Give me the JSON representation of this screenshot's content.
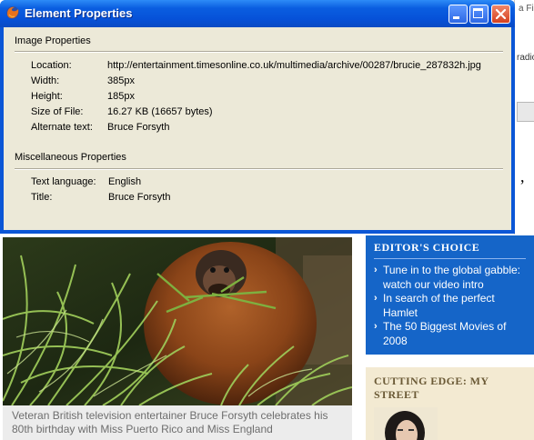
{
  "background_page": {
    "right_snippet_top": "a Fi",
    "right_snippet_radio": "radio",
    "right_snippet_comma": ",",
    "caption": "Veteran British television entertainer Bruce Forsyth celebrates his 80th birthday with Miss Puerto Rico and Miss England",
    "editors_choice": {
      "title": "EDITOR'S CHOICE",
      "items": [
        "Tune in to the global gabble: watch our video intro",
        "In search of the perfect Hamlet",
        "The 50 Biggest Movies of 2008"
      ]
    },
    "cutting_edge": {
      "title": "CUTTING EDGE: MY STREET"
    }
  },
  "dialog": {
    "title": "Element Properties",
    "image_section": {
      "heading": "Image Properties",
      "rows": [
        {
          "label": "Location:",
          "value": "http://entertainment.timesonline.co.uk/multimedia/archive/00287/brucie_287832h.jpg"
        },
        {
          "label": "Width:",
          "value": "385px"
        },
        {
          "label": "Height:",
          "value": "185px"
        },
        {
          "label": "Size of File:",
          "value": "16.27 KB (16657 bytes)"
        },
        {
          "label": "Alternate text:",
          "value": "Bruce Forsyth"
        }
      ]
    },
    "misc_section": {
      "heading": "Miscellaneous Properties",
      "rows": [
        {
          "label": "Text language:",
          "value": "English"
        },
        {
          "label": "Title:",
          "value": "Bruce Forsyth"
        }
      ]
    }
  }
}
